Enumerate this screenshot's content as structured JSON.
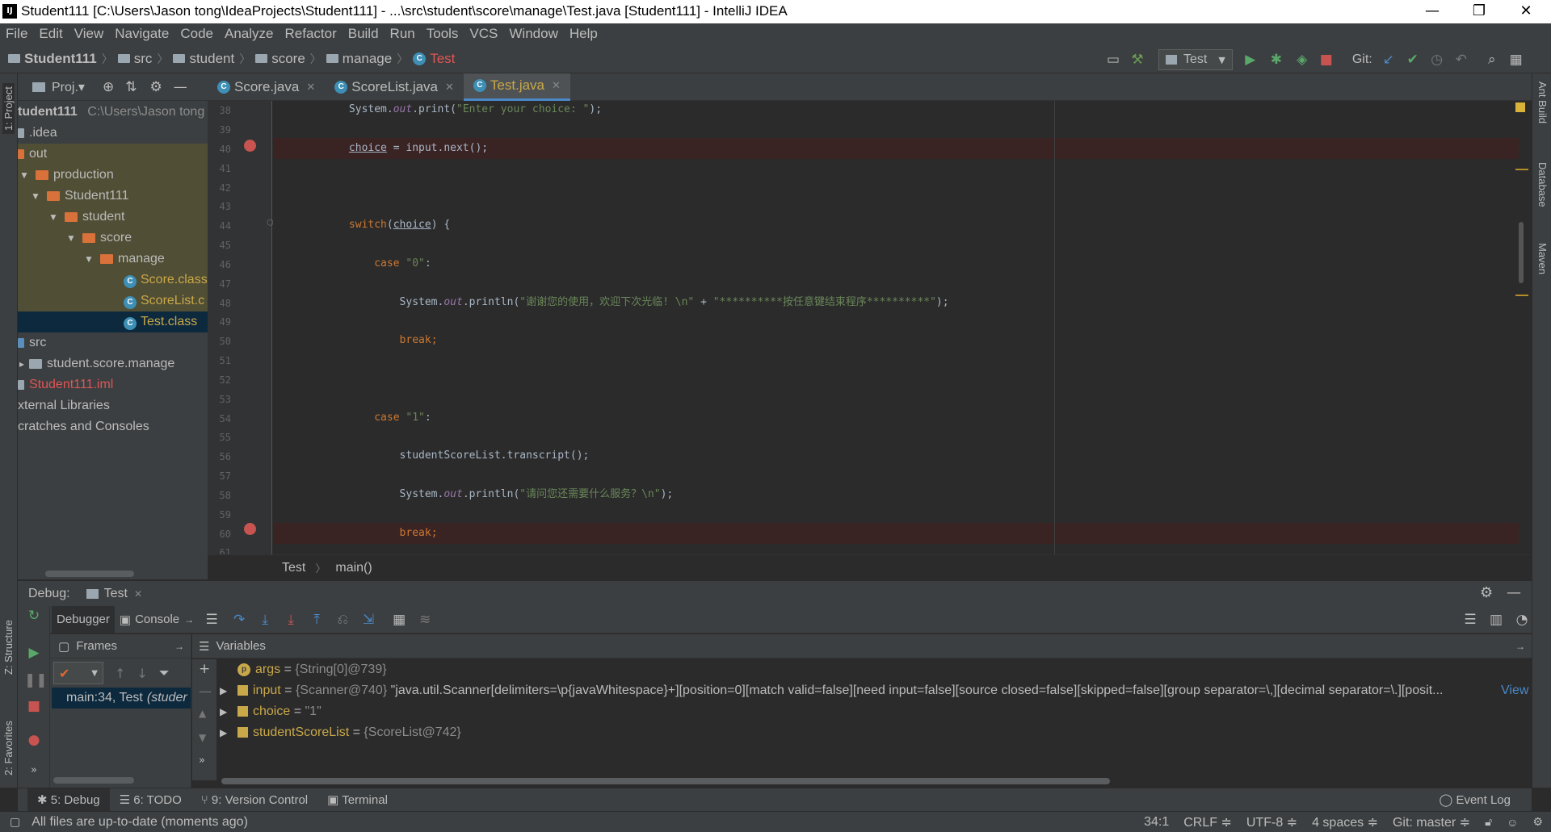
{
  "window": {
    "title": "Student111 [C:\\Users\\Jason tong\\IdeaProjects\\Student111] - ...\\src\\student\\score\\manage\\Test.java [Student111] - IntelliJ IDEA",
    "minimize": "—",
    "restore": "❐",
    "close": "✕"
  },
  "menu": [
    "File",
    "Edit",
    "View",
    "Navigate",
    "Code",
    "Analyze",
    "Refactor",
    "Build",
    "Run",
    "Tools",
    "VCS",
    "Window",
    "Help"
  ],
  "nav": {
    "crumbs": [
      "Student111",
      "src",
      "student",
      "score",
      "manage",
      "Test"
    ],
    "run_config": "Test",
    "git_label": "Git:"
  },
  "left_stripe": {
    "project": "1: Project",
    "structure": "Z: Structure",
    "favorites": "2: Favorites"
  },
  "right_stripe": {
    "ant": "Ant Build",
    "database": "Database",
    "maven": "Maven"
  },
  "project_panel": {
    "header": "Proj.▾",
    "root_name": "tudent111",
    "root_path": "C:\\Users\\Jason tong",
    "items": {
      "idea": ".idea",
      "out": "out",
      "production": "production",
      "student111": "Student111",
      "student": "student",
      "score": "score",
      "manage": "manage",
      "score_class": "Score.class",
      "scorelist_class": "ScoreList.c",
      "test_class": "Test.class",
      "src": "src",
      "pkg": "student.score.manage",
      "iml": "Student111.iml",
      "ext_libs": "xternal Libraries",
      "scratches": "cratches and Consoles"
    }
  },
  "editor": {
    "tabs": [
      {
        "label": "Score.java",
        "active": false
      },
      {
        "label": "ScoreList.java",
        "active": false
      },
      {
        "label": "Test.java",
        "active": true
      }
    ],
    "line_numbers": [
      "38",
      "39",
      "40",
      "41",
      "42",
      "43",
      "44",
      "45",
      "46",
      "47",
      "48",
      "49",
      "50",
      "51",
      "52",
      "53",
      "54",
      "55",
      "56",
      "57",
      "58",
      "59",
      "60",
      "61"
    ],
    "code": {
      "l38_a": "            System.",
      "l38_out": "out",
      "l38_b": ".print(",
      "l38_str": "\"Enter your choice: \"",
      "l38_c": ");",
      "l40_var": "choice",
      "l40_b": " = input.next();",
      "l44_kw": "switch",
      "l44_a": "(",
      "l44_var": "choice",
      "l44_b": ") {",
      "l46_kw": "case ",
      "l46_str": "\"0\"",
      "l46_b": ":",
      "l48_a": "System.",
      "l48_out": "out",
      "l48_b": ".println(",
      "l48_str1": "\"谢谢您的使用，欢迎下次光临! \\n\"",
      "l48_plus": " + ",
      "l48_str2": "\"**********按任意键结束程序**********\"",
      "l48_c": ");",
      "l50_kw": "break",
      "l50_b": ";",
      "l54_kw": "case ",
      "l54_str": "\"1\"",
      "l54_b": ":",
      "l56": "studentScoreList.transcript();",
      "l58_a": "System.",
      "l58_out": "out",
      "l58_b": ".println(",
      "l58_str": "\"请问您还需要什么服务？\\n\"",
      "l58_c": ");",
      "l60_kw": "break",
      "l60_b": ";"
    },
    "breadcrumb": [
      "Test",
      "main()"
    ]
  },
  "debug": {
    "label": "Debug:",
    "tab": "Test",
    "debugger_tab": "Debugger",
    "console_tab": "Console",
    "frames_title": "Frames",
    "variables_title": "Variables",
    "frame": "main:34, Test",
    "frame_pkg": "(studer",
    "variables": [
      {
        "name": "args",
        "eq": " = ",
        "type": "{String[0]@739}",
        "value": ""
      },
      {
        "name": "input",
        "eq": " = ",
        "type": "{Scanner@740}",
        "value": " \"java.util.Scanner[delimiters=\\p{javaWhitespace}+][position=0][match valid=false][need input=false][source closed=false][skipped=false][group separator=\\,][decimal separator=\\.][posit..."
      },
      {
        "name": "choice",
        "eq": " = ",
        "type": "\"1\"",
        "value": ""
      },
      {
        "name": "studentScoreList",
        "eq": " = ",
        "type": "{ScoreList@742}",
        "value": ""
      }
    ],
    "view_link": "View"
  },
  "bottom_tabs": [
    "5: Debug",
    "6: TODO",
    "9: Version Control",
    "Terminal"
  ],
  "event_log": "Event Log",
  "status": {
    "message": "All files are up-to-date (moments ago)",
    "position": "34:1",
    "line_sep": "CRLF ≑",
    "encoding": "UTF-8 ≑",
    "indent": "4 spaces ≑",
    "git": "Git: master ≑"
  },
  "colors": {
    "accent": "#4a88c7",
    "keyword": "#cc7832",
    "string": "#6a8759",
    "breakpoint": "#c75450"
  }
}
